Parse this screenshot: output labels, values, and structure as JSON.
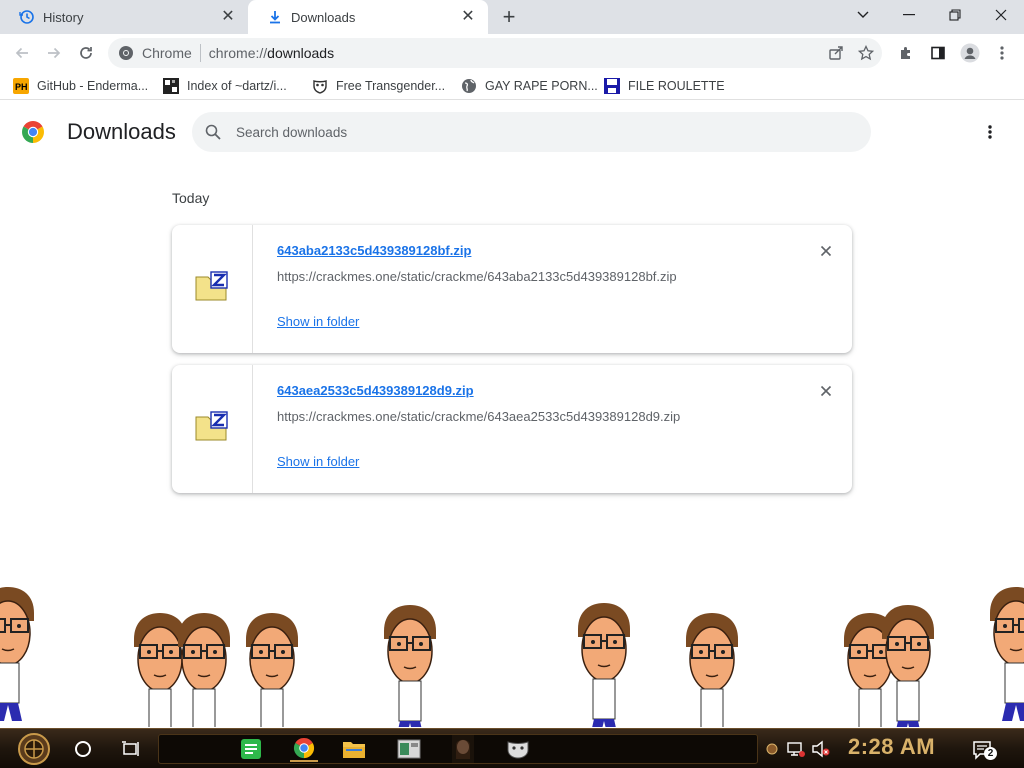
{
  "tabs": [
    {
      "label": "History",
      "icon": "history-icon"
    },
    {
      "label": "Downloads",
      "icon": "download-icon",
      "active": true
    }
  ],
  "toolbar": {
    "site_label": "Chrome",
    "url_prefix": "chrome://",
    "url_path": "downloads"
  },
  "bookmarks": [
    {
      "label": "GitHub - Enderma...",
      "icon": "ph-favicon"
    },
    {
      "label": "Index of ~dartz/i...",
      "icon": "pixel-favicon"
    },
    {
      "label": "Free Transgender...",
      "icon": "mask-favicon"
    },
    {
      "label": "GAY RAPE PORN...",
      "icon": "globe-icon"
    },
    {
      "label": "FILE ROULETTE",
      "icon": "floppy-favicon"
    }
  ],
  "page": {
    "title": "Downloads",
    "search_placeholder": "Search downloads",
    "section_label": "Today"
  },
  "downloads": [
    {
      "filename": "643aba2133c5d439389128bf.zip",
      "url": "https://crackmes.one/static/crackme/643aba2133c5d439389128bf.zip",
      "action": "Show in folder",
      "icon": "zip-file-icon"
    },
    {
      "filename": "643aea2533c5d439389128d9.zip",
      "url": "https://crackmes.one/static/crackme/643aea2533c5d439389128d9.zip",
      "action": "Show in folder",
      "icon": "zip-file-icon"
    }
  ],
  "taskbar": {
    "clock": "2:28 AM",
    "notification_count": "2"
  },
  "colors": {
    "tab_strip": "#dee1e6",
    "link_blue": "#1a73e8",
    "taskbar": "#1f160d",
    "clock": "#d9b26a"
  }
}
